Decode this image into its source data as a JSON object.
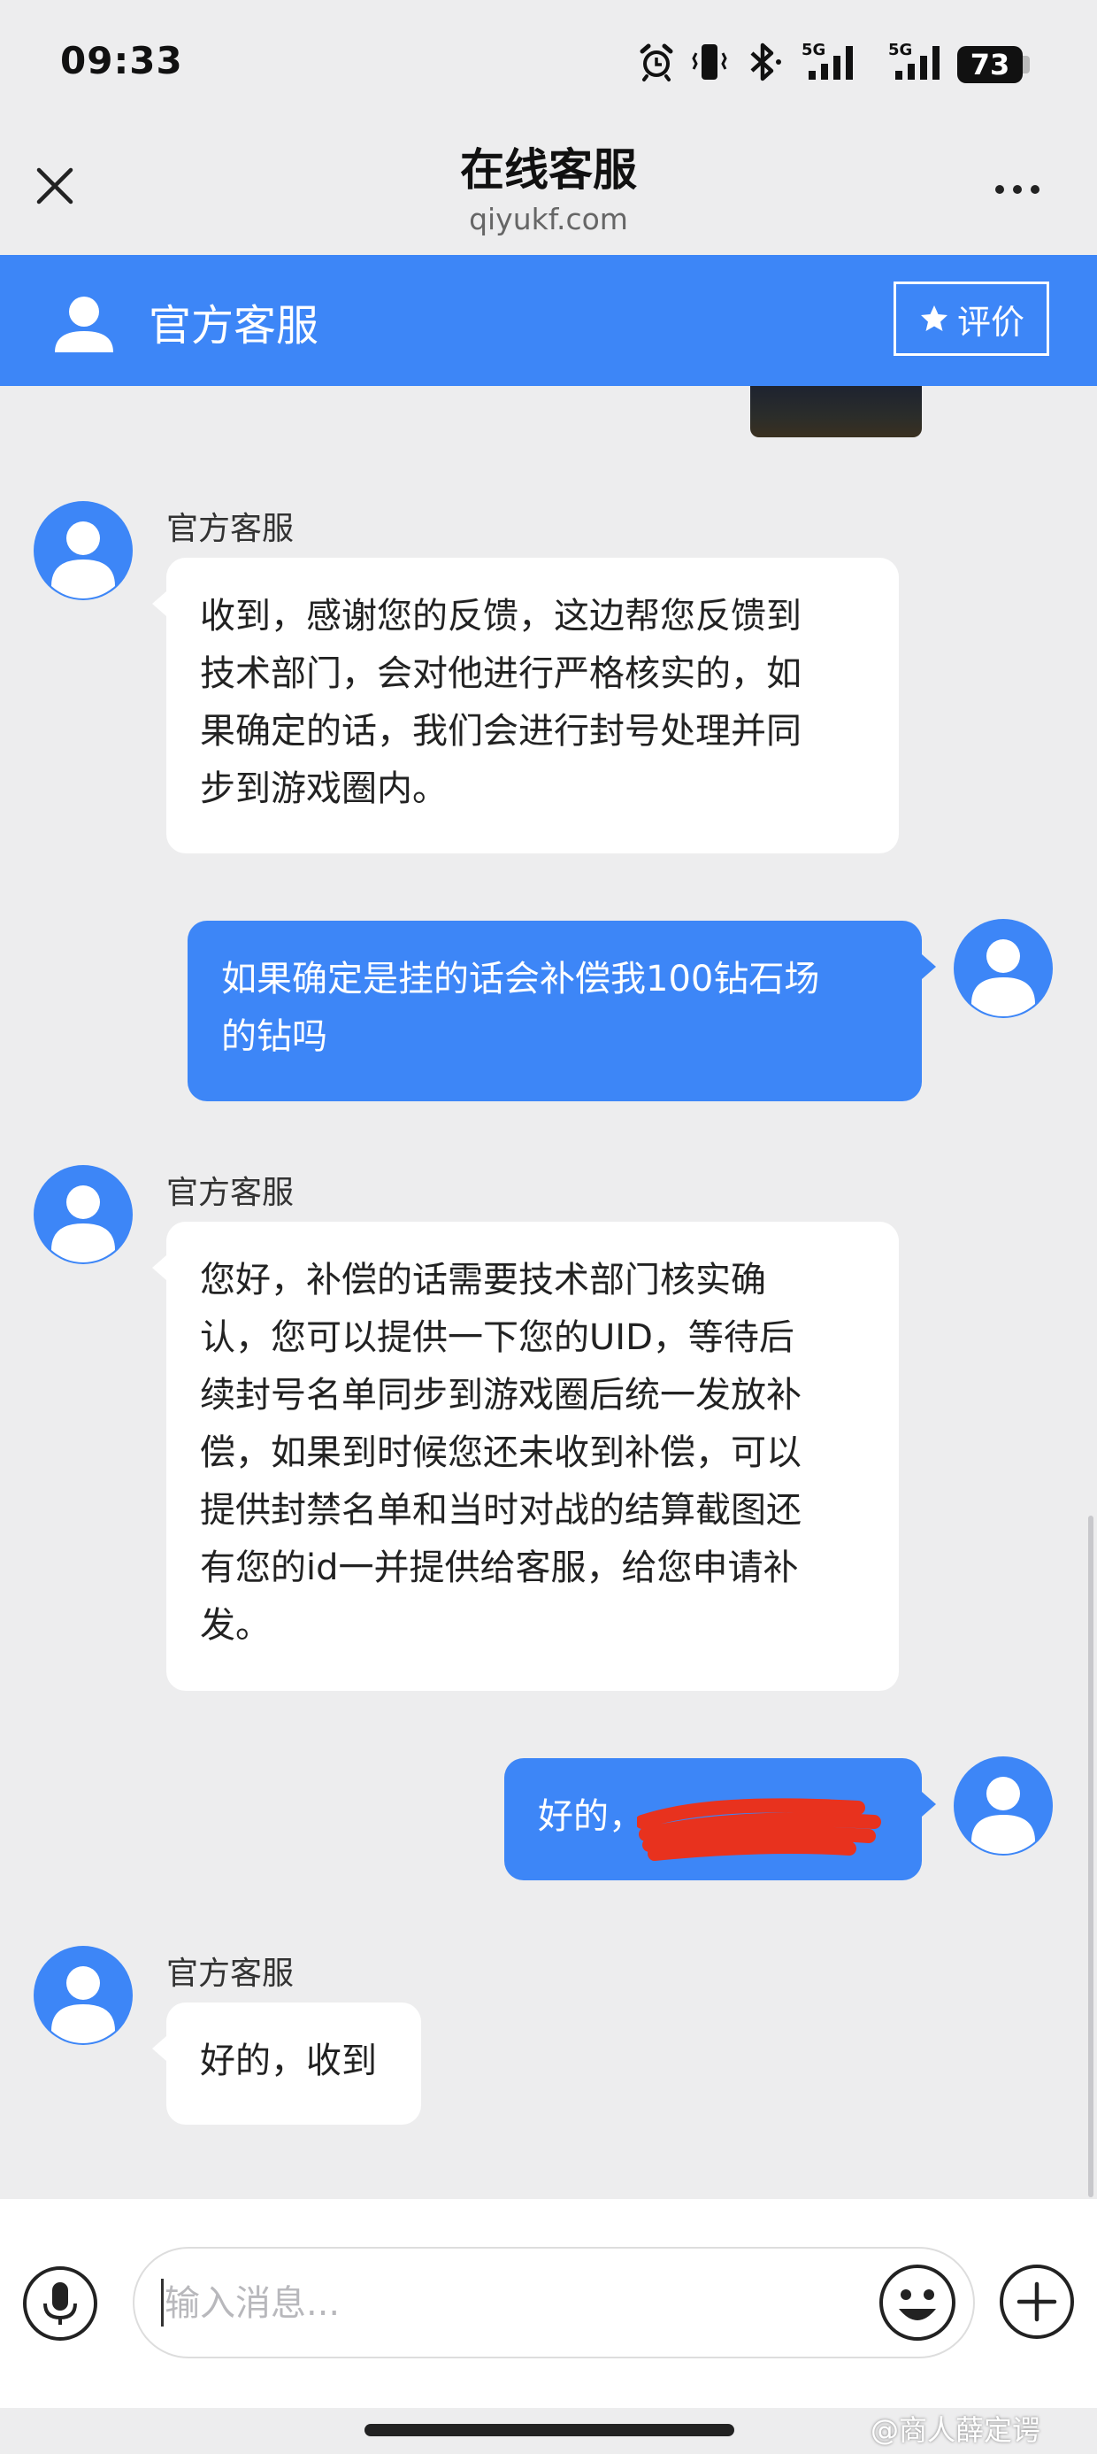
{
  "status_bar": {
    "time": "09:33",
    "battery": "73",
    "network_1": "5G",
    "network_2": "5G"
  },
  "title_bar": {
    "title": "在线客服",
    "subtitle": "qiyukf.com"
  },
  "chat_header": {
    "agent_name": "官方客服",
    "rate_label": "评价"
  },
  "messages": [
    {
      "sender": "官方客服",
      "direction": "in",
      "text": "收到，感谢您的反馈，这边帮您反馈到技术部门，会对他进行严格核实的，如果确定的话，我们会进行封号处理并同步到游戏圈内。",
      "lines": [
        "收到，感谢您的反馈，这边帮您反馈到",
        "技术部门，会对他进行严格核实的，如",
        "果确定的话，我们会进行封号处理并同",
        "步到游戏圈内。"
      ]
    },
    {
      "direction": "out",
      "text": "如果确定是挂的话会补偿我100钻石场的钻吗",
      "lines": [
        "如果确定是挂的话会补偿我100钻石场",
        "的钻吗"
      ]
    },
    {
      "sender": "官方客服",
      "direction": "in",
      "text": "您好，补偿的话需要技术部门核实确认，您可以提供一下您的UID，等待后续封号名单同步到游戏圈后统一发放补偿，如果到时候您还未收到补偿，可以提供封禁名单和当时对战的结算截图还有您的id一并提供给客服，给您申请补发。",
      "lines": [
        "您好，补偿的话需要技术部门核实确",
        "认，您可以提供一下您的UID，等待后",
        "续封号名单同步到游戏圈后统一发放补",
        "偿，如果到时候您还未收到补偿，可以",
        "提供封禁名单和当时对战的结算截图还",
        "有您的id一并提供给客服，给您申请补",
        "发。"
      ]
    },
    {
      "direction": "out",
      "text": "好的，",
      "redacted": true
    },
    {
      "sender": "官方客服",
      "direction": "in",
      "text": "好的，收到"
    }
  ],
  "input": {
    "placeholder": "输入消息..."
  },
  "watermark": "@商人薛定谔",
  "colors": {
    "accent": "#3d86f7",
    "background": "#ededee",
    "bubble_in": "#ffffff",
    "redaction": "#e8321e"
  },
  "icons": [
    "alarm-icon",
    "vibrate-icon",
    "bluetooth-icon",
    "signal-icon",
    "battery-icon",
    "close-icon",
    "more-icon",
    "user-avatar-icon",
    "star-icon",
    "mic-icon",
    "emoji-icon",
    "plus-icon"
  ]
}
